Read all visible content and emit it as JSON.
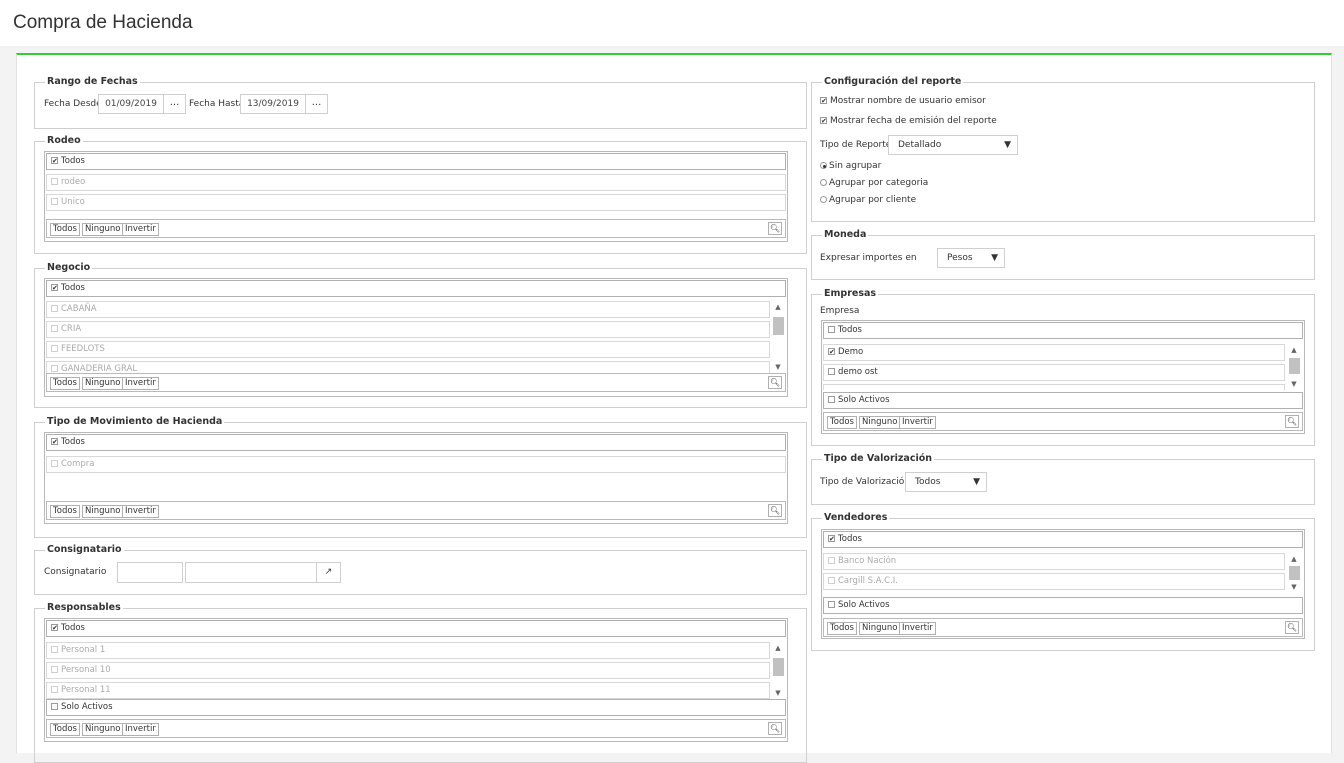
{
  "page": {
    "title": "Compra de Hacienda"
  },
  "colors": {
    "accent": "#33cc33",
    "border": "#cfcfcf"
  },
  "multiselect_buttons": {
    "all": "Todos",
    "none": "Ninguno",
    "invert": "Invertir",
    "search_icon": "search-icon"
  },
  "solo_activos": "Solo Activos",
  "rango": {
    "legend": "Rango de Fechas",
    "desde_label": "Fecha Desde",
    "desde_value": "01/09/2019",
    "hasta_label": "Fecha Hasta",
    "hasta_value": "13/09/2019",
    "picker": "..."
  },
  "rodeo": {
    "legend": "Rodeo",
    "head": "Todos",
    "items": [
      "rodeo",
      "Unico"
    ]
  },
  "negocio": {
    "legend": "Negocio",
    "head": "Todos",
    "items": [
      "CABAÑA",
      "CRIA",
      "FEEDLOTS",
      "GANADERIA GRAL"
    ]
  },
  "movimiento": {
    "legend": "Tipo de Movimiento de Hacienda",
    "head": "Todos",
    "items": [
      "Compra"
    ]
  },
  "consignatario": {
    "legend": "Consignatario",
    "label": "Consignatario",
    "code_value": "",
    "name_value": "",
    "open_icon": "external-link-icon"
  },
  "responsables": {
    "legend": "Responsables",
    "head": "Todos",
    "items": [
      "Personal 1",
      "Personal 10",
      "Personal 11"
    ]
  },
  "config": {
    "legend": "Configuración del reporte",
    "show_user": "Mostrar nombre de usuario emisor",
    "show_date": "Mostrar fecha de emisión del reporte",
    "tipo_label": "Tipo de Reporte",
    "tipo_value": "Detallado",
    "radios": [
      "Sin agrupar",
      "Agrupar por categoria",
      "Agrupar por cliente"
    ],
    "radio_selected": "Sin agrupar"
  },
  "moneda": {
    "legend": "Moneda",
    "label": "Expresar importes en",
    "value": "Pesos"
  },
  "empresas": {
    "legend": "Empresas",
    "sublabel": "Empresa",
    "head": "Todos",
    "items": [
      "Demo",
      "demo ost"
    ]
  },
  "valorizacion": {
    "legend": "Tipo de Valorización",
    "label": "Tipo de Valorización",
    "value": "Todos"
  },
  "vendedores": {
    "legend": "Vendedores",
    "head": "Todos",
    "items": [
      "Banco Nación",
      "Cargill S.A.C.I."
    ]
  }
}
